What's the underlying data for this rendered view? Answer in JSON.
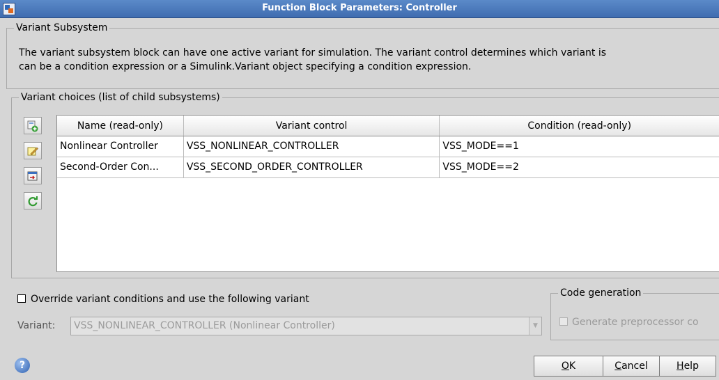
{
  "window": {
    "title": "Function Block Parameters: Controller"
  },
  "variant_subsystem": {
    "legend": "Variant Subsystem",
    "description_line1": "The variant subsystem block can have one active variant for simulation. The variant control determines which variant is",
    "description_line2": "can be a condition expression or a Simulink.Variant object specifying a condition expression."
  },
  "variant_choices": {
    "legend": "Variant choices (list of child subsystems)",
    "columns": [
      "Name (read-only)",
      "Variant control",
      "Condition (read-only)"
    ],
    "rows": [
      {
        "name": "Nonlinear Controller",
        "control": "VSS_NONLINEAR_CONTROLLER",
        "condition": "VSS_MODE==1"
      },
      {
        "name": "Second-Order Con...",
        "control": "VSS_SECOND_ORDER_CONTROLLER",
        "condition": "VSS_MODE==2"
      }
    ],
    "toolbar_icons": [
      "add-choice-icon",
      "edit-icon",
      "open-icon",
      "refresh-icon"
    ]
  },
  "override": {
    "label": "Override variant conditions and use the following variant",
    "checked": false
  },
  "variant_select": {
    "label": "Variant:",
    "value": "VSS_NONLINEAR_CONTROLLER (Nonlinear Controller)"
  },
  "code_generation": {
    "legend": "Code generation",
    "checkbox_label": "Generate preprocessor co"
  },
  "buttons": {
    "ok": {
      "mnemonic": "O",
      "rest": "K"
    },
    "cancel": {
      "mnemonic": "C",
      "rest": "ancel"
    },
    "help": {
      "mnemonic": "H",
      "rest": "elp"
    }
  },
  "colors": {
    "titlebar": "#3f6cb0",
    "dialog_bg": "#d6d6d6",
    "disabled_text": "#9a9a9a"
  }
}
